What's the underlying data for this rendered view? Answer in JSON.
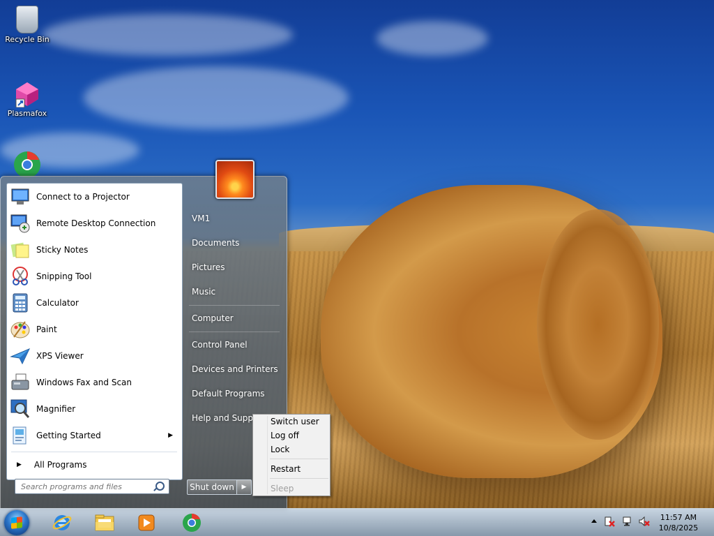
{
  "desktop": {
    "icons": [
      {
        "label": "Recycle Bin"
      },
      {
        "label": "Plasmafox"
      }
    ]
  },
  "start_menu": {
    "pinned_programs": [
      {
        "label": "Connect to a Projector",
        "icon": "projector-icon"
      },
      {
        "label": "Remote Desktop Connection",
        "icon": "remote-desktop-icon"
      },
      {
        "label": "Sticky Notes",
        "icon": "sticky-notes-icon"
      },
      {
        "label": "Snipping Tool",
        "icon": "scissors-icon"
      },
      {
        "label": "Calculator",
        "icon": "calculator-icon"
      },
      {
        "label": "Paint",
        "icon": "palette-icon"
      },
      {
        "label": "XPS Viewer",
        "icon": "paper-plane-icon"
      },
      {
        "label": "Windows Fax and Scan",
        "icon": "fax-icon"
      },
      {
        "label": "Magnifier",
        "icon": "magnifier-icon"
      },
      {
        "label": "Getting Started",
        "icon": "getting-started-icon",
        "has_submenu": true
      }
    ],
    "all_programs_label": "All Programs",
    "search_placeholder": "Search programs and files",
    "right_links": [
      "VM1",
      "Documents",
      "Pictures",
      "Music",
      "Computer",
      "Control Panel",
      "Devices and Printers",
      "Default Programs",
      "Help and Support"
    ],
    "shutdown_label": "Shut down"
  },
  "shutdown_menu": {
    "items": [
      "Switch user",
      "Log off",
      "Lock",
      "Restart",
      "Sleep"
    ],
    "disabled": [
      "Sleep"
    ]
  },
  "taskbar": {
    "pinned": [
      "internet-explorer-icon",
      "file-explorer-icon",
      "media-player-icon",
      "chrome-icon"
    ],
    "tray_icons": [
      "show-hidden-icons-icon",
      "action-center-icon",
      "network-icon",
      "volume-muted-icon"
    ],
    "time": "11:57 AM",
    "date": "10/8/2025"
  }
}
